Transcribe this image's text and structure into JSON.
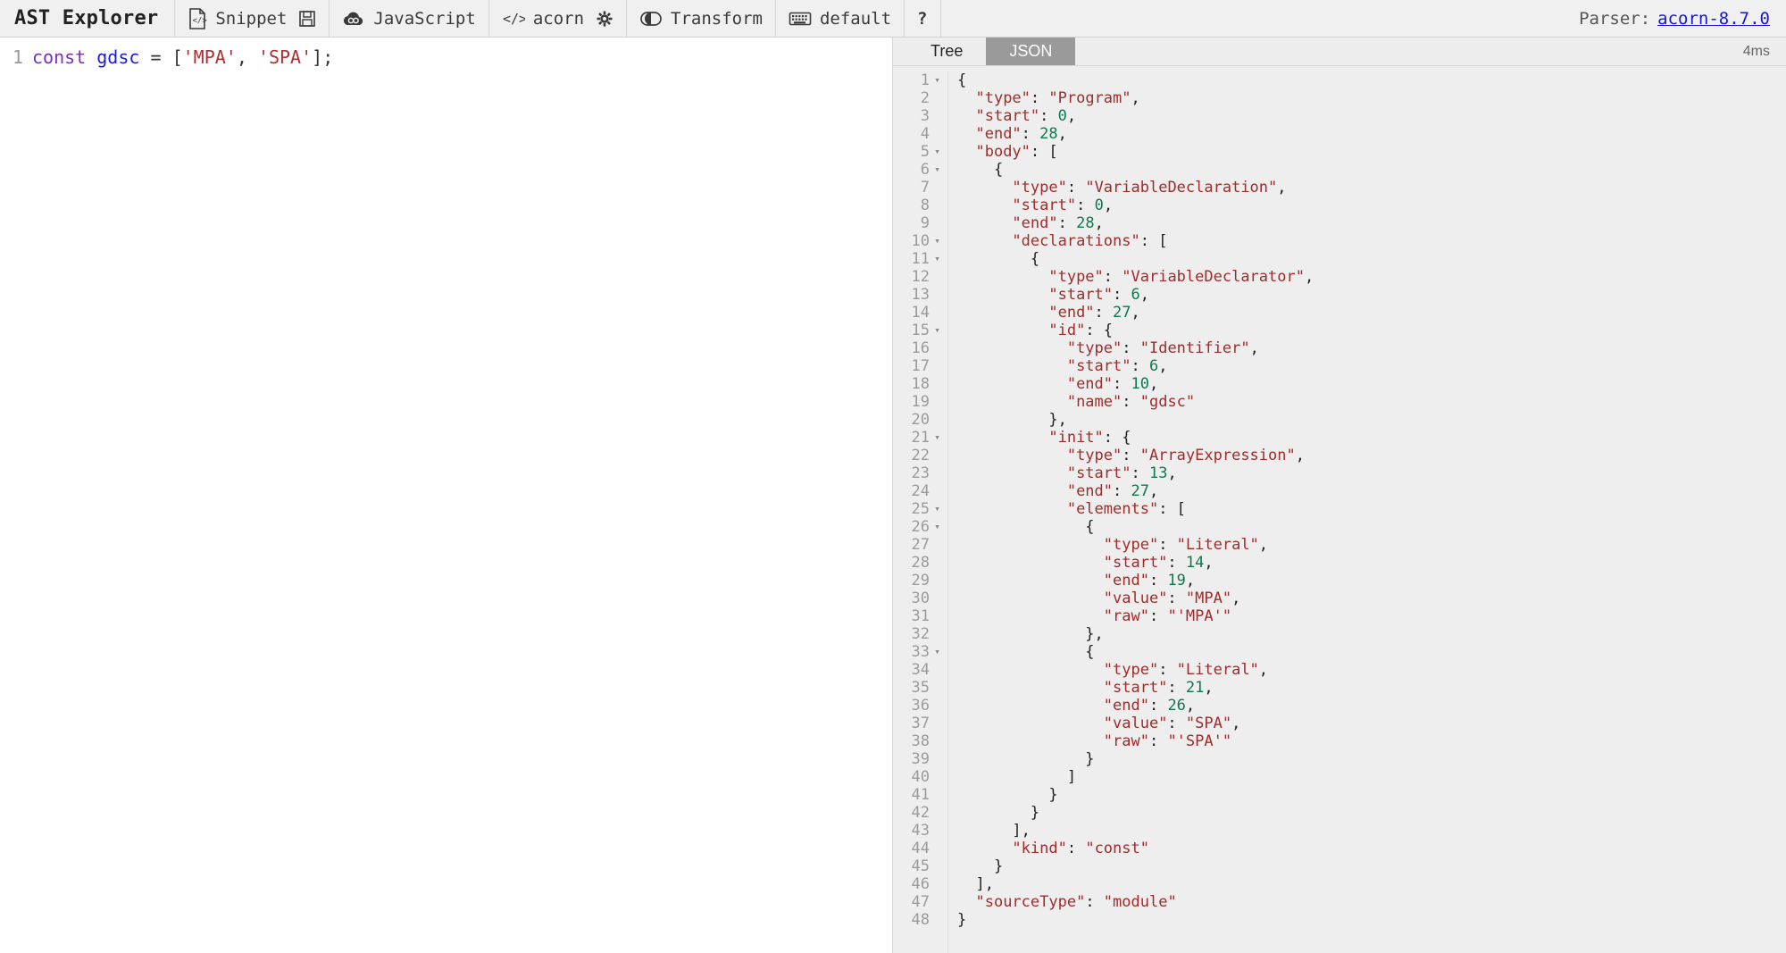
{
  "toolbar": {
    "brand": "AST Explorer",
    "groups": [
      {
        "icon": "code-file-icon",
        "label": "Snippet",
        "trailing_icon": "save-icon"
      },
      {
        "icon": "javascript-cloud-icon",
        "label": "JavaScript"
      },
      {
        "icon": "code-brackets-icon",
        "label": "acorn",
        "trailing_icon": "gear-icon"
      },
      {
        "icon": "transform-toggle-icon",
        "label": "Transform"
      },
      {
        "icon": "keyboard-icon",
        "label": "default"
      },
      {
        "icon": "help-icon",
        "label": "?"
      }
    ],
    "parser_label": "Parser:",
    "parser_version": "acorn-8.7.0",
    "link_color": "#1717d4"
  },
  "editor": {
    "line_number": "1",
    "tokens": [
      {
        "text": "const",
        "type": "kw"
      },
      {
        "text": " ",
        "type": "pun"
      },
      {
        "text": "gdsc",
        "type": "var"
      },
      {
        "text": " ",
        "type": "pun"
      },
      {
        "text": "=",
        "type": "op"
      },
      {
        "text": " ",
        "type": "pun"
      },
      {
        "text": "[",
        "type": "pun"
      },
      {
        "text": "'MPA'",
        "type": "str"
      },
      {
        "text": ", ",
        "type": "pun"
      },
      {
        "text": "'SPA'",
        "type": "str"
      },
      {
        "text": "]",
        "type": "pun"
      },
      {
        "text": ";",
        "type": "pun"
      }
    ],
    "source": "const gdsc = ['MPA', 'SPA'];"
  },
  "output": {
    "tabs": [
      {
        "label": "Tree",
        "active": false
      },
      {
        "label": "JSON",
        "active": true
      }
    ],
    "timing": "4ms",
    "active_tab_bg": "#9a9a9a"
  },
  "json_output": {
    "line_count": 48,
    "fold_lines": [
      1,
      5,
      6,
      10,
      11,
      15,
      21,
      25,
      26,
      33
    ],
    "lines": [
      {
        "n": 1,
        "indent": 0,
        "parts": [
          {
            "t": "{",
            "c": "pun"
          }
        ]
      },
      {
        "n": 2,
        "indent": 1,
        "parts": [
          {
            "t": "\"type\"",
            "c": "key"
          },
          {
            "t": ": ",
            "c": "pun"
          },
          {
            "t": "\"Program\"",
            "c": "str"
          },
          {
            "t": ",",
            "c": "pun"
          }
        ]
      },
      {
        "n": 3,
        "indent": 1,
        "parts": [
          {
            "t": "\"start\"",
            "c": "key"
          },
          {
            "t": ": ",
            "c": "pun"
          },
          {
            "t": "0",
            "c": "num"
          },
          {
            "t": ",",
            "c": "pun"
          }
        ]
      },
      {
        "n": 4,
        "indent": 1,
        "parts": [
          {
            "t": "\"end\"",
            "c": "key"
          },
          {
            "t": ": ",
            "c": "pun"
          },
          {
            "t": "28",
            "c": "num"
          },
          {
            "t": ",",
            "c": "pun"
          }
        ]
      },
      {
        "n": 5,
        "indent": 1,
        "parts": [
          {
            "t": "\"body\"",
            "c": "key"
          },
          {
            "t": ": [",
            "c": "pun"
          }
        ]
      },
      {
        "n": 6,
        "indent": 2,
        "parts": [
          {
            "t": "{",
            "c": "pun"
          }
        ]
      },
      {
        "n": 7,
        "indent": 3,
        "parts": [
          {
            "t": "\"type\"",
            "c": "key"
          },
          {
            "t": ": ",
            "c": "pun"
          },
          {
            "t": "\"VariableDeclaration\"",
            "c": "str"
          },
          {
            "t": ",",
            "c": "pun"
          }
        ]
      },
      {
        "n": 8,
        "indent": 3,
        "parts": [
          {
            "t": "\"start\"",
            "c": "key"
          },
          {
            "t": ": ",
            "c": "pun"
          },
          {
            "t": "0",
            "c": "num"
          },
          {
            "t": ",",
            "c": "pun"
          }
        ]
      },
      {
        "n": 9,
        "indent": 3,
        "parts": [
          {
            "t": "\"end\"",
            "c": "key"
          },
          {
            "t": ": ",
            "c": "pun"
          },
          {
            "t": "28",
            "c": "num"
          },
          {
            "t": ",",
            "c": "pun"
          }
        ]
      },
      {
        "n": 10,
        "indent": 3,
        "parts": [
          {
            "t": "\"declarations\"",
            "c": "key"
          },
          {
            "t": ": [",
            "c": "pun"
          }
        ]
      },
      {
        "n": 11,
        "indent": 4,
        "parts": [
          {
            "t": "{",
            "c": "pun"
          }
        ]
      },
      {
        "n": 12,
        "indent": 5,
        "parts": [
          {
            "t": "\"type\"",
            "c": "key"
          },
          {
            "t": ": ",
            "c": "pun"
          },
          {
            "t": "\"VariableDeclarator\"",
            "c": "str"
          },
          {
            "t": ",",
            "c": "pun"
          }
        ]
      },
      {
        "n": 13,
        "indent": 5,
        "parts": [
          {
            "t": "\"start\"",
            "c": "key"
          },
          {
            "t": ": ",
            "c": "pun"
          },
          {
            "t": "6",
            "c": "num"
          },
          {
            "t": ",",
            "c": "pun"
          }
        ]
      },
      {
        "n": 14,
        "indent": 5,
        "parts": [
          {
            "t": "\"end\"",
            "c": "key"
          },
          {
            "t": ": ",
            "c": "pun"
          },
          {
            "t": "27",
            "c": "num"
          },
          {
            "t": ",",
            "c": "pun"
          }
        ]
      },
      {
        "n": 15,
        "indent": 5,
        "parts": [
          {
            "t": "\"id\"",
            "c": "key"
          },
          {
            "t": ": {",
            "c": "pun"
          }
        ]
      },
      {
        "n": 16,
        "indent": 6,
        "parts": [
          {
            "t": "\"type\"",
            "c": "key"
          },
          {
            "t": ": ",
            "c": "pun"
          },
          {
            "t": "\"Identifier\"",
            "c": "str"
          },
          {
            "t": ",",
            "c": "pun"
          }
        ]
      },
      {
        "n": 17,
        "indent": 6,
        "parts": [
          {
            "t": "\"start\"",
            "c": "key"
          },
          {
            "t": ": ",
            "c": "pun"
          },
          {
            "t": "6",
            "c": "num"
          },
          {
            "t": ",",
            "c": "pun"
          }
        ]
      },
      {
        "n": 18,
        "indent": 6,
        "parts": [
          {
            "t": "\"end\"",
            "c": "key"
          },
          {
            "t": ": ",
            "c": "pun"
          },
          {
            "t": "10",
            "c": "num"
          },
          {
            "t": ",",
            "c": "pun"
          }
        ]
      },
      {
        "n": 19,
        "indent": 6,
        "parts": [
          {
            "t": "\"name\"",
            "c": "key"
          },
          {
            "t": ": ",
            "c": "pun"
          },
          {
            "t": "\"gdsc\"",
            "c": "str"
          }
        ]
      },
      {
        "n": 20,
        "indent": 5,
        "parts": [
          {
            "t": "},",
            "c": "pun"
          }
        ]
      },
      {
        "n": 21,
        "indent": 5,
        "parts": [
          {
            "t": "\"init\"",
            "c": "key"
          },
          {
            "t": ": {",
            "c": "pun"
          }
        ]
      },
      {
        "n": 22,
        "indent": 6,
        "parts": [
          {
            "t": "\"type\"",
            "c": "key"
          },
          {
            "t": ": ",
            "c": "pun"
          },
          {
            "t": "\"ArrayExpression\"",
            "c": "str"
          },
          {
            "t": ",",
            "c": "pun"
          }
        ]
      },
      {
        "n": 23,
        "indent": 6,
        "parts": [
          {
            "t": "\"start\"",
            "c": "key"
          },
          {
            "t": ": ",
            "c": "pun"
          },
          {
            "t": "13",
            "c": "num"
          },
          {
            "t": ",",
            "c": "pun"
          }
        ]
      },
      {
        "n": 24,
        "indent": 6,
        "parts": [
          {
            "t": "\"end\"",
            "c": "key"
          },
          {
            "t": ": ",
            "c": "pun"
          },
          {
            "t": "27",
            "c": "num"
          },
          {
            "t": ",",
            "c": "pun"
          }
        ]
      },
      {
        "n": 25,
        "indent": 6,
        "parts": [
          {
            "t": "\"elements\"",
            "c": "key"
          },
          {
            "t": ": [",
            "c": "pun"
          }
        ]
      },
      {
        "n": 26,
        "indent": 7,
        "parts": [
          {
            "t": "{",
            "c": "pun"
          }
        ]
      },
      {
        "n": 27,
        "indent": 8,
        "parts": [
          {
            "t": "\"type\"",
            "c": "key"
          },
          {
            "t": ": ",
            "c": "pun"
          },
          {
            "t": "\"Literal\"",
            "c": "str"
          },
          {
            "t": ",",
            "c": "pun"
          }
        ]
      },
      {
        "n": 28,
        "indent": 8,
        "parts": [
          {
            "t": "\"start\"",
            "c": "key"
          },
          {
            "t": ": ",
            "c": "pun"
          },
          {
            "t": "14",
            "c": "num"
          },
          {
            "t": ",",
            "c": "pun"
          }
        ]
      },
      {
        "n": 29,
        "indent": 8,
        "parts": [
          {
            "t": "\"end\"",
            "c": "key"
          },
          {
            "t": ": ",
            "c": "pun"
          },
          {
            "t": "19",
            "c": "num"
          },
          {
            "t": ",",
            "c": "pun"
          }
        ]
      },
      {
        "n": 30,
        "indent": 8,
        "parts": [
          {
            "t": "\"value\"",
            "c": "key"
          },
          {
            "t": ": ",
            "c": "pun"
          },
          {
            "t": "\"MPA\"",
            "c": "str"
          },
          {
            "t": ",",
            "c": "pun"
          }
        ]
      },
      {
        "n": 31,
        "indent": 8,
        "parts": [
          {
            "t": "\"raw\"",
            "c": "key"
          },
          {
            "t": ": ",
            "c": "pun"
          },
          {
            "t": "\"'MPA'\"",
            "c": "str"
          }
        ]
      },
      {
        "n": 32,
        "indent": 7,
        "parts": [
          {
            "t": "},",
            "c": "pun"
          }
        ]
      },
      {
        "n": 33,
        "indent": 7,
        "parts": [
          {
            "t": "{",
            "c": "pun"
          }
        ]
      },
      {
        "n": 34,
        "indent": 8,
        "parts": [
          {
            "t": "\"type\"",
            "c": "key"
          },
          {
            "t": ": ",
            "c": "pun"
          },
          {
            "t": "\"Literal\"",
            "c": "str"
          },
          {
            "t": ",",
            "c": "pun"
          }
        ]
      },
      {
        "n": 35,
        "indent": 8,
        "parts": [
          {
            "t": "\"start\"",
            "c": "key"
          },
          {
            "t": ": ",
            "c": "pun"
          },
          {
            "t": "21",
            "c": "num"
          },
          {
            "t": ",",
            "c": "pun"
          }
        ]
      },
      {
        "n": 36,
        "indent": 8,
        "parts": [
          {
            "t": "\"end\"",
            "c": "key"
          },
          {
            "t": ": ",
            "c": "pun"
          },
          {
            "t": "26",
            "c": "num"
          },
          {
            "t": ",",
            "c": "pun"
          }
        ]
      },
      {
        "n": 37,
        "indent": 8,
        "parts": [
          {
            "t": "\"value\"",
            "c": "key"
          },
          {
            "t": ": ",
            "c": "pun"
          },
          {
            "t": "\"SPA\"",
            "c": "str"
          },
          {
            "t": ",",
            "c": "pun"
          }
        ]
      },
      {
        "n": 38,
        "indent": 8,
        "parts": [
          {
            "t": "\"raw\"",
            "c": "key"
          },
          {
            "t": ": ",
            "c": "pun"
          },
          {
            "t": "\"'SPA'\"",
            "c": "str"
          }
        ]
      },
      {
        "n": 39,
        "indent": 7,
        "parts": [
          {
            "t": "}",
            "c": "pun"
          }
        ]
      },
      {
        "n": 40,
        "indent": 6,
        "parts": [
          {
            "t": "]",
            "c": "pun"
          }
        ]
      },
      {
        "n": 41,
        "indent": 5,
        "parts": [
          {
            "t": "}",
            "c": "pun"
          }
        ]
      },
      {
        "n": 42,
        "indent": 4,
        "parts": [
          {
            "t": "}",
            "c": "pun"
          }
        ]
      },
      {
        "n": 43,
        "indent": 3,
        "parts": [
          {
            "t": "],",
            "c": "pun"
          }
        ]
      },
      {
        "n": 44,
        "indent": 3,
        "parts": [
          {
            "t": "\"kind\"",
            "c": "key"
          },
          {
            "t": ": ",
            "c": "pun"
          },
          {
            "t": "\"const\"",
            "c": "str"
          }
        ]
      },
      {
        "n": 45,
        "indent": 2,
        "parts": [
          {
            "t": "}",
            "c": "pun"
          }
        ]
      },
      {
        "n": 46,
        "indent": 1,
        "parts": [
          {
            "t": "],",
            "c": "pun"
          }
        ]
      },
      {
        "n": 47,
        "indent": 1,
        "parts": [
          {
            "t": "\"sourceType\"",
            "c": "key"
          },
          {
            "t": ": ",
            "c": "pun"
          },
          {
            "t": "\"module\"",
            "c": "str"
          }
        ]
      },
      {
        "n": 48,
        "indent": 0,
        "parts": [
          {
            "t": "}",
            "c": "pun"
          }
        ]
      }
    ]
  }
}
